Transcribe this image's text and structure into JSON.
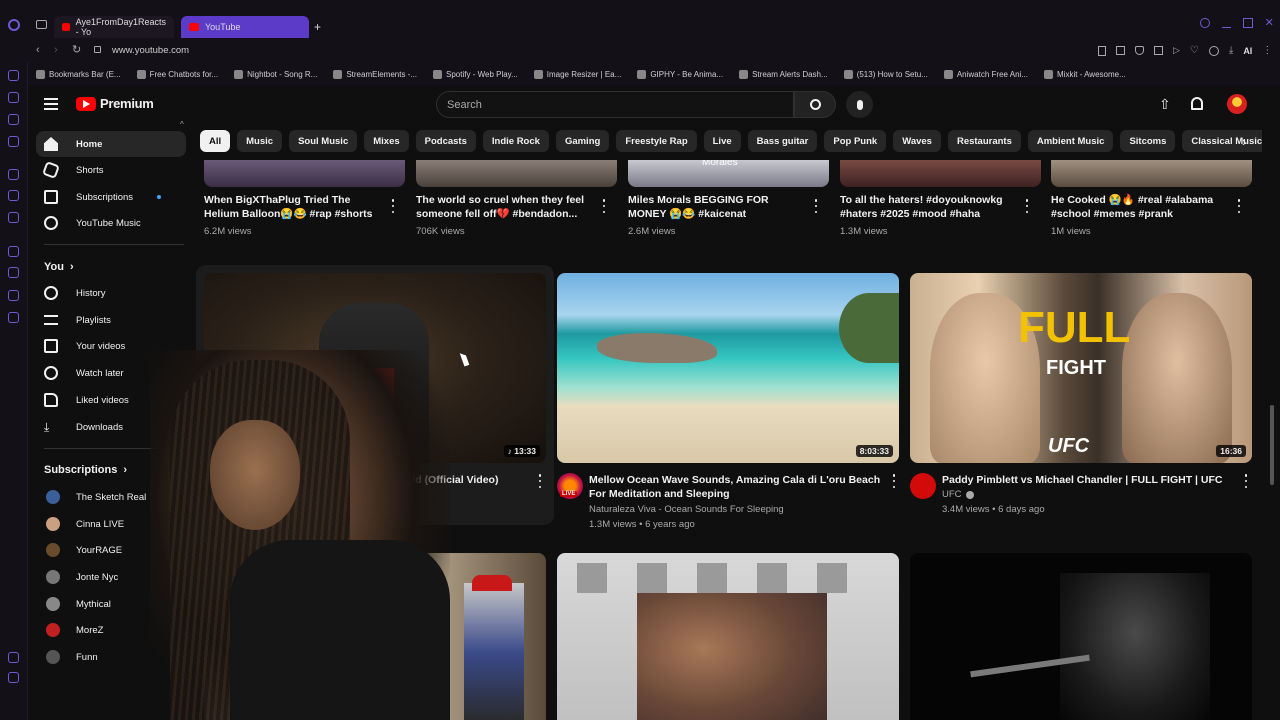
{
  "browser": {
    "tabs": [
      {
        "label": "Aye1FromDay1Reacts - Yo"
      },
      {
        "label": "YouTube"
      }
    ],
    "new_tab_label": "+",
    "url": "www.youtube.com",
    "bookmarks": [
      "Bookmarks Bar (E...",
      "Free Chatbots for...",
      "Nightbot - Song R...",
      "StreamElements -...",
      "Spotify - Web Play...",
      "Image Resizer | Ea...",
      "GIPHY - Be Anima...",
      "Stream Alerts Dash...",
      "(513) How to Setu...",
      "Aniwatch Free Ani...",
      "Mixkit - Awesome..."
    ],
    "ai_label": "AI"
  },
  "header": {
    "logo_text": "Premium",
    "search_placeholder": "Search"
  },
  "chips": [
    "All",
    "Music",
    "Soul Music",
    "Mixes",
    "Podcasts",
    "Indie Rock",
    "Gaming",
    "Freestyle Rap",
    "Live",
    "Bass guitar",
    "Pop Punk",
    "Waves",
    "Restaurants",
    "Ambient Music",
    "Sitcoms",
    "Classical Music"
  ],
  "sidebar": {
    "main": [
      {
        "label": "Home"
      },
      {
        "label": "Shorts"
      },
      {
        "label": "Subscriptions"
      },
      {
        "label": "YouTube Music"
      }
    ],
    "you_heading": "You",
    "you_items": [
      {
        "label": "History"
      },
      {
        "label": "Playlists"
      },
      {
        "label": "Your videos"
      },
      {
        "label": "Watch later"
      },
      {
        "label": "Liked videos"
      },
      {
        "label": "Downloads"
      }
    ],
    "subs_heading": "Subscriptions",
    "subs": [
      {
        "label": "The Sketch Real"
      },
      {
        "label": "Cinna LIVE"
      },
      {
        "label": "YourRAGE"
      },
      {
        "label": "Jonte Nyc"
      },
      {
        "label": "Mythical"
      },
      {
        "label": "MoreZ"
      },
      {
        "label": "Funn"
      }
    ]
  },
  "shorts_row": [
    {
      "title": "When BigXThaPlug Tried The Helium Balloon😭😂 #rap #shorts",
      "views": "6.2M views"
    },
    {
      "title": "The world so cruel when they feel someone fell off💔 #bendadon...",
      "views": "706K views"
    },
    {
      "title": "Miles Morals BEGGING FOR MONEY 😭😂 #kaicenat #milesmorales ...",
      "views": "2.6M views"
    },
    {
      "title": "To all the haters! #doyouknowkg #haters #2025 #mood #haha",
      "views": "1.3M views"
    },
    {
      "title": "He Cooked 😭🔥 #real #alabama #school #memes #prank #trending...",
      "views": "1M views"
    }
  ],
  "videos": [
    {
      "title": "Rock My World (Official Video)",
      "duration": "13:33",
      "channel": "",
      "meta": ""
    },
    {
      "title": "Mellow Ocean Wave Sounds, Amazing Cala di L'oru Beach For Meditation and Sleeping",
      "duration": "8:03:33",
      "channel": "Naturaleza Viva - Ocean Sounds For Sleeping",
      "meta": "1.3M views • 6 years ago",
      "live_badge": "LIVE"
    },
    {
      "title": "Paddy Pimblett vs Michael Chandler | FULL FIGHT | UFC 324",
      "duration": "16:36",
      "channel": "UFC",
      "meta": "3.4M views • 6 days ago",
      "thumb_text_1": "FULL",
      "thumb_text_2": "FIGHT",
      "thumb_text_3": "UFC"
    }
  ],
  "thumb_misc": {
    "morales": "Morales"
  },
  "colors": {
    "accent": "#ff0000",
    "tab_active": "#5b3bc8",
    "browser_accent": "#6b5bd6"
  }
}
